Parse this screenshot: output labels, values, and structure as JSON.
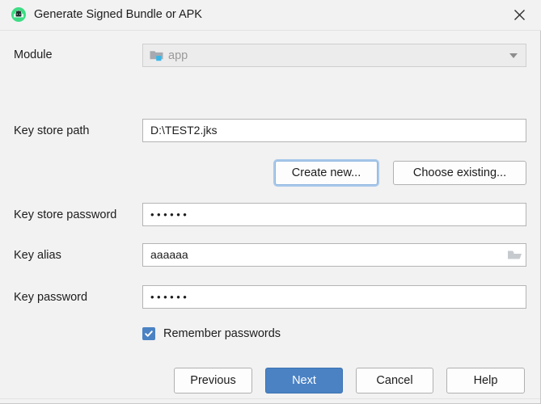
{
  "window": {
    "title": "Generate Signed Bundle or APK",
    "icon": "android-studio-icon",
    "close_label": "×"
  },
  "form": {
    "module": {
      "label": "Module",
      "value": "app",
      "icon": "module-folder-icon",
      "dropdown_icon": "chevron-down-icon",
      "disabled": true
    },
    "key_store_path": {
      "label": "Key store path",
      "value": "D:\\TEST2.jks"
    },
    "create_new": {
      "label": "Create new..."
    },
    "choose_existing": {
      "label": "Choose existing..."
    },
    "key_store_password": {
      "label": "Key store password",
      "value": "••••••"
    },
    "key_alias": {
      "label": "Key alias",
      "value": "aaaaaa",
      "browse_icon": "folder-icon"
    },
    "key_password": {
      "label": "Key password",
      "value": "••••••"
    },
    "remember_passwords": {
      "label": "Remember passwords",
      "checked": true
    }
  },
  "footer": {
    "previous": "Previous",
    "next": "Next",
    "cancel": "Cancel",
    "help": "Help"
  },
  "colors": {
    "accent": "#4a82c4",
    "focus_ring": "#a9c9ea",
    "background": "#f2f2f2",
    "field_border": "#b4b4b4",
    "android_green": "#3ddc84"
  }
}
